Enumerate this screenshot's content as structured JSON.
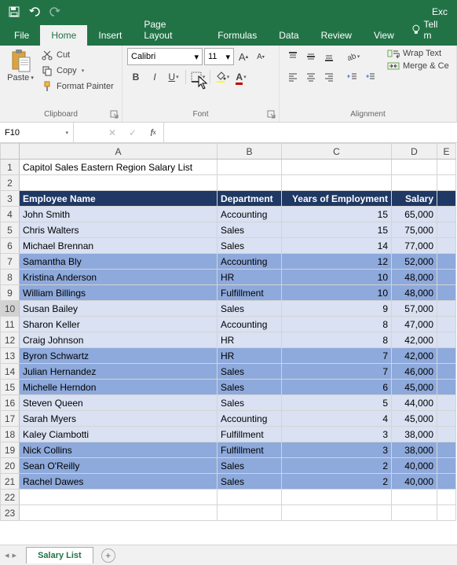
{
  "app_title": "Exc",
  "tabs": [
    "File",
    "Home",
    "Insert",
    "Page Layout",
    "Formulas",
    "Data",
    "Review",
    "View"
  ],
  "tell_me": "Tell m",
  "clipboard": {
    "paste": "Paste",
    "cut": "Cut",
    "copy": "Copy",
    "format_painter": "Format Painter",
    "group": "Clipboard"
  },
  "font": {
    "name": "Calibri",
    "size": "11",
    "group": "Font"
  },
  "alignment": {
    "wrap": "Wrap Text",
    "merge": "Merge & Ce",
    "group": "Alignment"
  },
  "name_box": "F10",
  "formula": "",
  "cols": {
    "A": 252,
    "B": 82,
    "C": 140,
    "D": 58,
    "E": 24
  },
  "title_cell": "Capitol Sales Eastern Region Salary List",
  "headers": {
    "A": "Employee Name",
    "B": "Department",
    "C": "Years of Employment",
    "D": "Salary"
  },
  "rows": [
    {
      "n": 4,
      "band": "light",
      "A": "John Smith",
      "B": "Accounting",
      "C": "15",
      "D": "65,000"
    },
    {
      "n": 5,
      "band": "light",
      "A": "Chris Walters",
      "B": "Sales",
      "C": "15",
      "D": "75,000"
    },
    {
      "n": 6,
      "band": "light",
      "A": "Michael Brennan",
      "B": "Sales",
      "C": "14",
      "D": "77,000"
    },
    {
      "n": 7,
      "band": "dark",
      "A": "Samantha Bly",
      "B": "Accounting",
      "C": "12",
      "D": "52,000"
    },
    {
      "n": 8,
      "band": "dark",
      "A": "Kristina Anderson",
      "B": "HR",
      "C": "10",
      "D": "48,000"
    },
    {
      "n": 9,
      "band": "dark",
      "A": "William Billings",
      "B": "Fulfillment",
      "C": "10",
      "D": "48,000"
    },
    {
      "n": 10,
      "band": "light",
      "A": "Susan Bailey",
      "B": "Sales",
      "C": "9",
      "D": "57,000"
    },
    {
      "n": 11,
      "band": "light",
      "A": "Sharon Keller",
      "B": "Accounting",
      "C": "8",
      "D": "47,000"
    },
    {
      "n": 12,
      "band": "light",
      "A": "Craig Johnson",
      "B": "HR",
      "C": "8",
      "D": "42,000"
    },
    {
      "n": 13,
      "band": "dark",
      "A": "Byron Schwartz",
      "B": "HR",
      "C": "7",
      "D": "42,000"
    },
    {
      "n": 14,
      "band": "dark",
      "A": "Julian Hernandez",
      "B": "Sales",
      "C": "7",
      "D": "46,000"
    },
    {
      "n": 15,
      "band": "dark",
      "A": "Michelle Herndon",
      "B": "Sales",
      "C": "6",
      "D": "45,000"
    },
    {
      "n": 16,
      "band": "light",
      "A": "Steven Queen",
      "B": "Sales",
      "C": "5",
      "D": "44,000"
    },
    {
      "n": 17,
      "band": "light",
      "A": "Sarah Myers",
      "B": "Accounting",
      "C": "4",
      "D": "45,000"
    },
    {
      "n": 18,
      "band": "light",
      "A": "Kaley Ciambotti",
      "B": "Fulfillment",
      "C": "3",
      "D": "38,000"
    },
    {
      "n": 19,
      "band": "dark",
      "A": "Nick Collins",
      "B": "Fulfillment",
      "C": "3",
      "D": "38,000"
    },
    {
      "n": 20,
      "band": "dark",
      "A": "Sean O'Reilly",
      "B": "Sales",
      "C": "2",
      "D": "40,000"
    },
    {
      "n": 21,
      "band": "dark",
      "A": "Rachel Dawes",
      "B": "Sales",
      "C": "2",
      "D": "40,000"
    }
  ],
  "sheet_tab": "Salary List",
  "chart_data": {
    "type": "table",
    "title": "Capitol Sales Eastern Region Salary List",
    "columns": [
      "Employee Name",
      "Department",
      "Years of Employment",
      "Salary"
    ],
    "rows": [
      [
        "John Smith",
        "Accounting",
        15,
        65000
      ],
      [
        "Chris Walters",
        "Sales",
        15,
        75000
      ],
      [
        "Michael Brennan",
        "Sales",
        14,
        77000
      ],
      [
        "Samantha Bly",
        "Accounting",
        12,
        52000
      ],
      [
        "Kristina Anderson",
        "HR",
        10,
        48000
      ],
      [
        "William Billings",
        "Fulfillment",
        10,
        48000
      ],
      [
        "Susan Bailey",
        "Sales",
        9,
        57000
      ],
      [
        "Sharon Keller",
        "Accounting",
        8,
        47000
      ],
      [
        "Craig Johnson",
        "HR",
        8,
        42000
      ],
      [
        "Byron Schwartz",
        "HR",
        7,
        42000
      ],
      [
        "Julian Hernandez",
        "Sales",
        7,
        46000
      ],
      [
        "Michelle Herndon",
        "Sales",
        6,
        45000
      ],
      [
        "Steven Queen",
        "Sales",
        5,
        44000
      ],
      [
        "Sarah Myers",
        "Accounting",
        4,
        45000
      ],
      [
        "Kaley Ciambotti",
        "Fulfillment",
        3,
        38000
      ],
      [
        "Nick Collins",
        "Fulfillment",
        3,
        38000
      ],
      [
        "Sean O'Reilly",
        "Sales",
        2,
        40000
      ],
      [
        "Rachel Dawes",
        "Sales",
        2,
        40000
      ]
    ]
  }
}
